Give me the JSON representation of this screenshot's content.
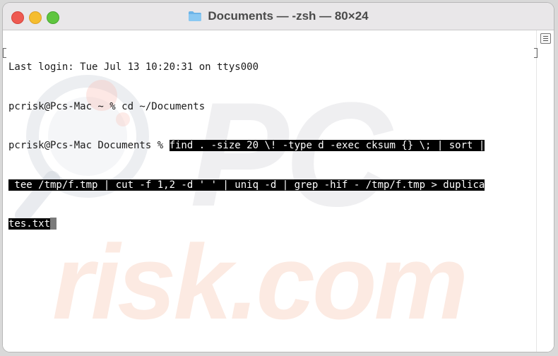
{
  "window": {
    "title": "Documents — -zsh — 80×24",
    "folder_icon": "folder-icon",
    "colors": {
      "close": "#ee5a52",
      "minimize": "#f5bd2f",
      "zoom": "#5fc53f",
      "selection": "#000000"
    }
  },
  "terminal": {
    "line1": "Last login: Tue Jul 13 10:20:31 on ttys000",
    "line2": "pcrisk@Pcs-Mac ~ % cd ~/Documents",
    "line3_prompt": "pcrisk@Pcs-Mac Documents % ",
    "line3_cmd": "find . -size 20 \\! -type d -exec cksum {} \\; | sort |",
    "line4": " tee /tmp/f.tmp | cut -f 1,2 -d ' ' | uniq -d | grep -hif - /tmp/f.tmp > duplica",
    "line5": "tes.txt"
  },
  "watermark": {
    "pc": "PC",
    "risk": "risk.com"
  }
}
